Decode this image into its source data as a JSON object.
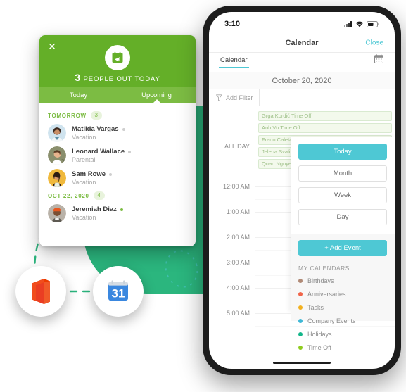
{
  "ooo_card": {
    "close_icon": "close-icon",
    "header_icon": "calendar-plane-icon",
    "count": "3",
    "count_label": "PEOPLE OUT TODAY",
    "tabs": [
      {
        "label": "Today",
        "active": false
      },
      {
        "label": "Upcoming",
        "active": true
      }
    ],
    "groups": [
      {
        "title": "TOMORROW",
        "count": "3",
        "people": [
          {
            "name": "Matilda Vargas",
            "reason": "Vacation",
            "dot": "#cfcfcf"
          },
          {
            "name": "Leonard Wallace",
            "reason": "Parental",
            "dot": "#cfcfcf"
          },
          {
            "name": "Sam Rowe",
            "reason": "Vacation",
            "dot": "#cfcfcf"
          }
        ]
      },
      {
        "title": "OCT 22, 2020",
        "count": "4",
        "people": [
          {
            "name": "Jeremiah Diaz",
            "reason": "Vacation",
            "dot": "#7cbc43"
          }
        ]
      }
    ]
  },
  "phone": {
    "status": {
      "time": "3:10",
      "icons": [
        "signal-icon",
        "wifi-icon",
        "battery-icon"
      ]
    },
    "nav": {
      "title": "Calendar",
      "close": "Close"
    },
    "subtabs": {
      "tab": "Calendar",
      "right_icon": "calendar-month-icon"
    },
    "date": "October 20, 2020",
    "filter": {
      "icon": "filter-icon",
      "label": "Add Filter",
      "input_value": "",
      "placeholder": ""
    },
    "calendar": {
      "all_day_label": "ALL DAY",
      "all_day_events": [
        "Grga Kordić Time Off",
        "Anh Vu Time Off",
        "Frano Ćaleta Time Off",
        "Jelena Svalina Time Off",
        "Quan Nguyen Time Off"
      ],
      "hours": [
        "12:00 AM",
        "1:00 AM",
        "2:00 AM",
        "3:00 AM",
        "4:00 AM",
        "5:00 AM"
      ]
    },
    "panel": {
      "view_buttons": [
        {
          "label": "Today",
          "active": true
        },
        {
          "label": "Month",
          "active": false
        },
        {
          "label": "Week",
          "active": false
        },
        {
          "label": "Day",
          "active": false
        }
      ],
      "add_event": "+ Add Event",
      "my_calendars_title": "MY CALENDARS",
      "my_calendars": [
        {
          "label": "Birthdays",
          "color": "#b08a76"
        },
        {
          "label": "Anniversaries",
          "color": "#f06449"
        },
        {
          "label": "Tasks",
          "color": "#f2b01e"
        },
        {
          "label": "Company Events",
          "color": "#3fb8d6"
        },
        {
          "label": "Holidays",
          "color": "#13b68a"
        },
        {
          "label": "Time Off",
          "color": "#8fcc1f"
        }
      ]
    }
  },
  "integrations": [
    {
      "name": "office-365-icon",
      "label": "Office 365"
    },
    {
      "name": "google-calendar-icon",
      "label": "Google Calendar",
      "day": "31"
    }
  ],
  "colors": {
    "green_header": "#64af28",
    "green_tabs": "#7cbc43",
    "blob_green": "#2bb67e",
    "teal_accent": "#4ec8d4",
    "dashed_teal": "#2bb67e"
  }
}
